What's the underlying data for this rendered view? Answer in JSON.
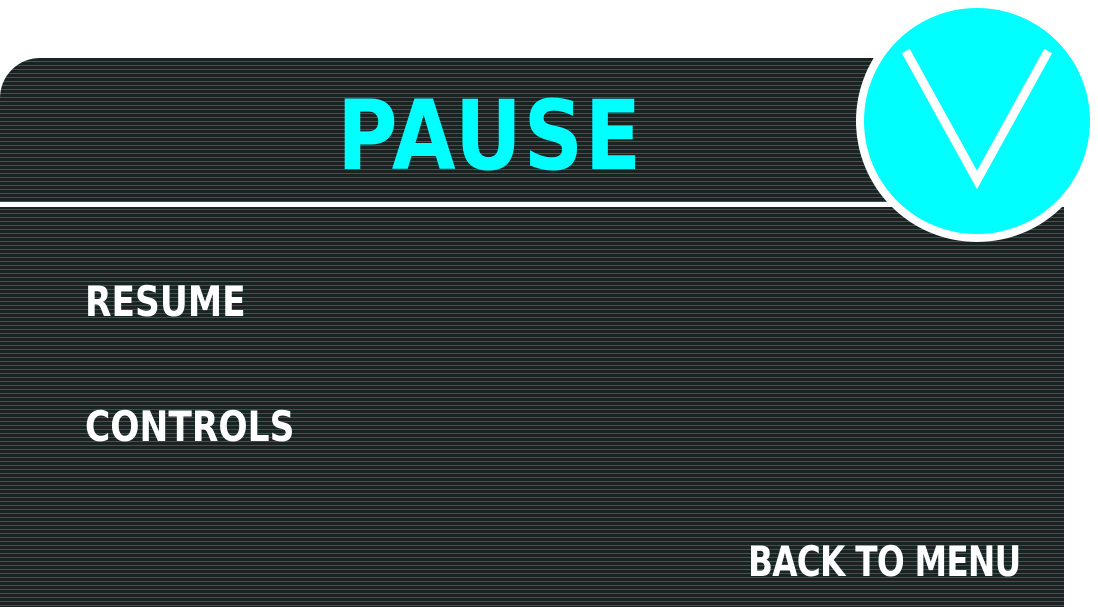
{
  "pause_menu": {
    "title": "PAUSE",
    "items": [
      {
        "label": "RESUME"
      },
      {
        "label": "CONTROLS"
      }
    ],
    "back_label": "BACK TO MENU",
    "badge_icon": "chevron-v-icon"
  },
  "colors": {
    "accent": "#00ffff",
    "panel": "#1e2726",
    "stripe": "#3a5550",
    "text": "#ffffff"
  }
}
